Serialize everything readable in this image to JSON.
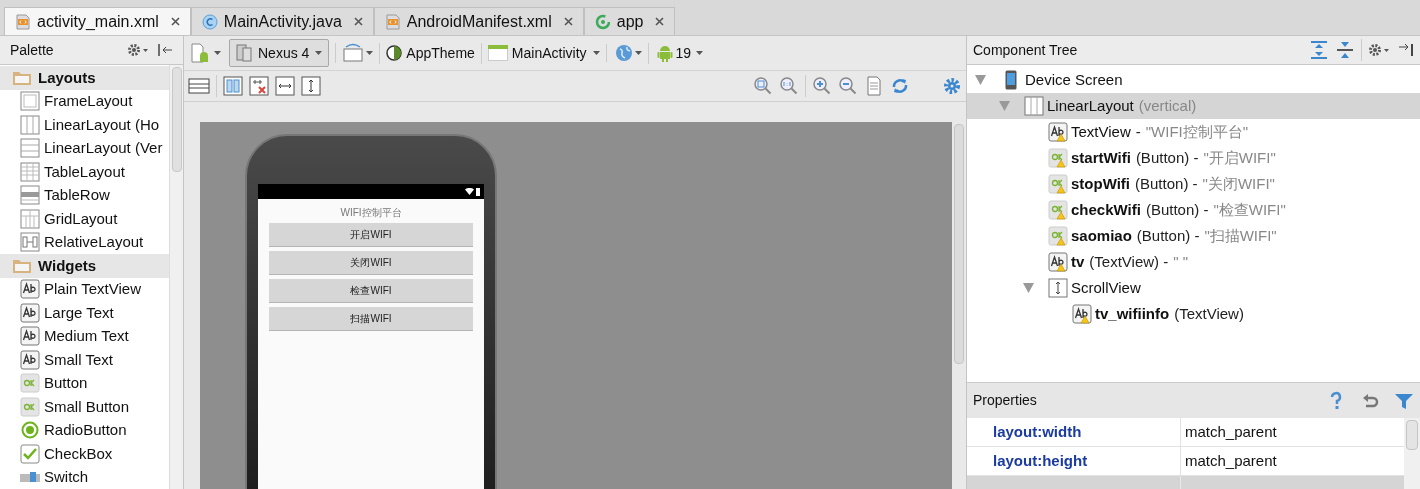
{
  "tabs": [
    {
      "label": "activity_main.xml",
      "kind": "xml",
      "selected": true
    },
    {
      "label": "MainActivity.java",
      "kind": "java",
      "selected": false
    },
    {
      "label": "AndroidManifest.xml",
      "kind": "xml",
      "selected": false
    },
    {
      "label": "app",
      "kind": "module",
      "selected": false
    }
  ],
  "palette": {
    "title": "Palette",
    "groups": [
      {
        "label": "Layouts",
        "items": [
          {
            "label": "FrameLayout",
            "kind": "frame"
          },
          {
            "label": "LinearLayout (Ho",
            "kind": "linear-h"
          },
          {
            "label": "LinearLayout (Ver",
            "kind": "linear-v"
          },
          {
            "label": "TableLayout",
            "kind": "table"
          },
          {
            "label": "TableRow",
            "kind": "tablerow"
          },
          {
            "label": "GridLayout",
            "kind": "grid"
          },
          {
            "label": "RelativeLayout",
            "kind": "relative"
          }
        ]
      },
      {
        "label": "Widgets",
        "items": [
          {
            "label": "Plain TextView",
            "kind": "text"
          },
          {
            "label": "Large Text",
            "kind": "text"
          },
          {
            "label": "Medium Text",
            "kind": "text"
          },
          {
            "label": "Small Text",
            "kind": "text"
          },
          {
            "label": "Button",
            "kind": "button"
          },
          {
            "label": "Small Button",
            "kind": "button"
          },
          {
            "label": "RadioButton",
            "kind": "radio"
          },
          {
            "label": "CheckBox",
            "kind": "checkbox"
          },
          {
            "label": "Switch",
            "kind": "switch"
          }
        ]
      }
    ]
  },
  "toolbar": {
    "device": "Nexus 4",
    "theme": "AppTheme",
    "activity": "MainActivity",
    "api": "19"
  },
  "preview": {
    "title": "WIFI控制平台",
    "buttons": [
      "开启WIFI",
      "关闭WIFI",
      "检查WIFI",
      "扫描WIFI"
    ]
  },
  "component_tree": {
    "title": "Component Tree",
    "items": [
      {
        "name": "Device Screen",
        "kind": "device",
        "expanded": true,
        "selected": false,
        "children": [
          {
            "name": "LinearLayout",
            "value": "(vertical)",
            "kind": "linear",
            "expanded": true,
            "selected": true,
            "children": [
              {
                "name": "TextView",
                "bold": false,
                "suffix": "-",
                "value": "\"WIFI控制平台\"",
                "kind": "text",
                "warning": true,
                "selected": false
              },
              {
                "name": "startWifi",
                "bold": true,
                "suffix": "(Button) -",
                "value": "\"开启WIFI\"",
                "kind": "button",
                "warning": true,
                "selected": false
              },
              {
                "name": "stopWifi",
                "bold": true,
                "suffix": "(Button) -",
                "value": "\"关闭WIFI\"",
                "kind": "button",
                "warning": true,
                "selected": false
              },
              {
                "name": "checkWifi",
                "bold": true,
                "suffix": "(Button) -",
                "value": "\"检查WIFI\"",
                "kind": "button",
                "warning": true,
                "selected": false
              },
              {
                "name": "saomiao",
                "bold": true,
                "suffix": "(Button) -",
                "value": "\"扫描WIFI\"",
                "kind": "button",
                "warning": true,
                "selected": false
              },
              {
                "name": "tv",
                "bold": true,
                "suffix": "(TextView) -",
                "value": "\" \"",
                "kind": "text",
                "warning": true,
                "selected": false
              },
              {
                "name": "ScrollView",
                "bold": false,
                "kind": "scroll",
                "expanded": true,
                "selected": false,
                "children": [
                  {
                    "name": "tv_wifiinfo",
                    "bold": true,
                    "suffix": "(TextView)",
                    "kind": "text",
                    "warning": true,
                    "selected": false
                  }
                ]
              }
            ]
          }
        ]
      }
    ]
  },
  "properties": {
    "title": "Properties",
    "rows": [
      {
        "name": "layout:width",
        "value": "match_parent"
      },
      {
        "name": "layout:height",
        "value": "match_parent"
      }
    ]
  }
}
